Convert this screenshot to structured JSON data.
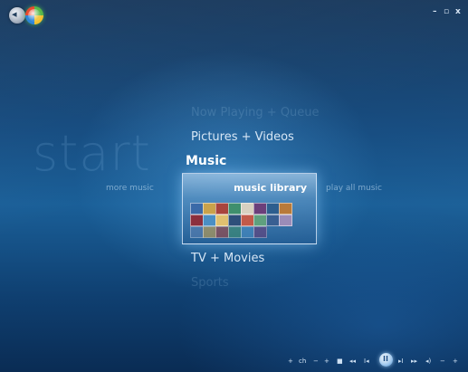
{
  "window": {
    "controls": {
      "minimize": "–",
      "maximize": "▫",
      "close": "x"
    }
  },
  "header": {
    "back_icon": "back-arrow-icon",
    "logo_icon": "windows-media-center-logo"
  },
  "background_title": "start",
  "menu": {
    "items": [
      {
        "label": "Now Playing + Queue",
        "state": "faded"
      },
      {
        "label": "Pictures + Videos",
        "state": "normal"
      },
      {
        "label": "Music",
        "state": "selected"
      },
      {
        "label": "TV + Movies",
        "state": "normal"
      },
      {
        "label": "Sports",
        "state": "faded"
      }
    ],
    "submenu": {
      "left": "more music",
      "focused": "music library",
      "right": "play all music"
    }
  },
  "transport": {
    "buttons": [
      "+",
      "ch",
      "−",
      "+",
      "■",
      "◂◂",
      "I◂",
      "II",
      "▸I",
      "▸▸",
      "◂)",
      "−",
      "+"
    ]
  },
  "colors": {
    "background_dark": "#0d2f55",
    "background_mid": "#1a5f98",
    "text": "#e6f0fb"
  }
}
